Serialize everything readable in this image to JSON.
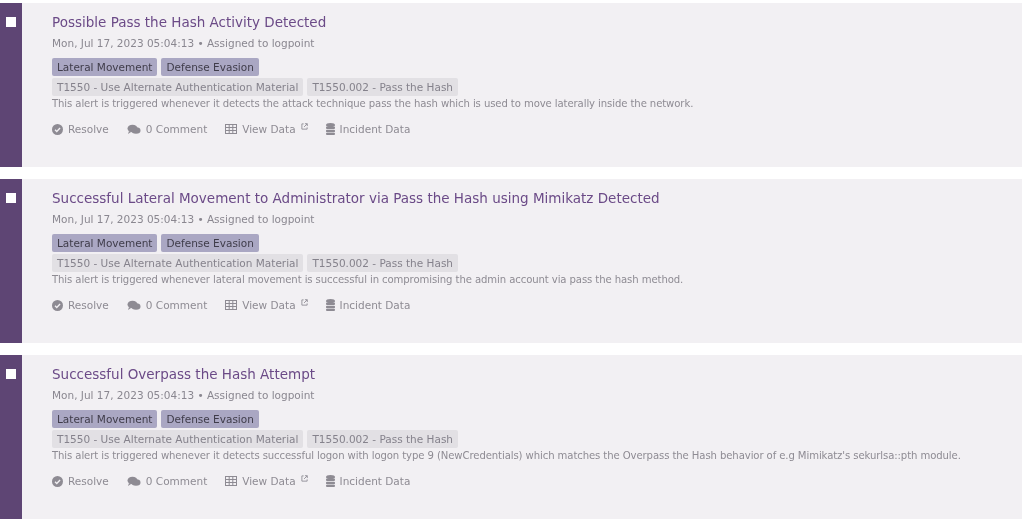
{
  "alerts": [
    {
      "checked": false,
      "title": "Possible Pass the Hash Activity Detected",
      "meta": "Mon, Jul 17, 2023 05:04:13 • Assigned to logpoint",
      "tactics": [
        "Lateral Movement",
        "Defense Evasion"
      ],
      "techniques": [
        "T1550 - Use Alternate Authentication Material",
        "T1550.002 - Pass the Hash"
      ],
      "description": "This alert is triggered whenever it detects the attack technique pass the hash which is used to move laterally inside the network.",
      "actions": [
        {
          "kind": "resolve",
          "label": "Resolve"
        },
        {
          "kind": "comment",
          "label": "0 Comment"
        },
        {
          "kind": "view",
          "label": "View Data"
        },
        {
          "kind": "incident",
          "label": "Incident Data"
        }
      ]
    },
    {
      "checked": false,
      "title": "Successful Lateral Movement to Administrator via Pass the Hash using Mimikatz Detected",
      "meta": "Mon, Jul 17, 2023 05:04:13 • Assigned to logpoint",
      "tactics": [
        "Lateral Movement",
        "Defense Evasion"
      ],
      "techniques": [
        "T1550 - Use Alternate Authentication Material",
        "T1550.002 - Pass the Hash"
      ],
      "description": "This alert is triggered whenever lateral movement is successful in compromising the admin account via pass the hash method.",
      "actions": [
        {
          "kind": "resolve",
          "label": "Resolve"
        },
        {
          "kind": "comment",
          "label": "0 Comment"
        },
        {
          "kind": "view",
          "label": "View Data"
        },
        {
          "kind": "incident",
          "label": "Incident Data"
        }
      ]
    },
    {
      "checked": false,
      "title": "Successful Overpass the Hash Attempt",
      "meta": "Mon, Jul 17, 2023 05:04:13 • Assigned to logpoint",
      "tactics": [
        "Lateral Movement",
        "Defense Evasion"
      ],
      "techniques": [
        "T1550 - Use Alternate Authentication Material",
        "T1550.002 - Pass the Hash"
      ],
      "description": "This alert is triggered whenever it detects successful logon with logon type 9 (NewCredentials) which matches the Overpass the Hash behavior of e.g Mimikatz's sekurlsa::pth module.",
      "actions": [
        {
          "kind": "resolve",
          "label": "Resolve"
        },
        {
          "kind": "comment",
          "label": "0 Comment"
        },
        {
          "kind": "view",
          "label": "View Data"
        },
        {
          "kind": "incident",
          "label": "Incident Data"
        }
      ]
    }
  ]
}
